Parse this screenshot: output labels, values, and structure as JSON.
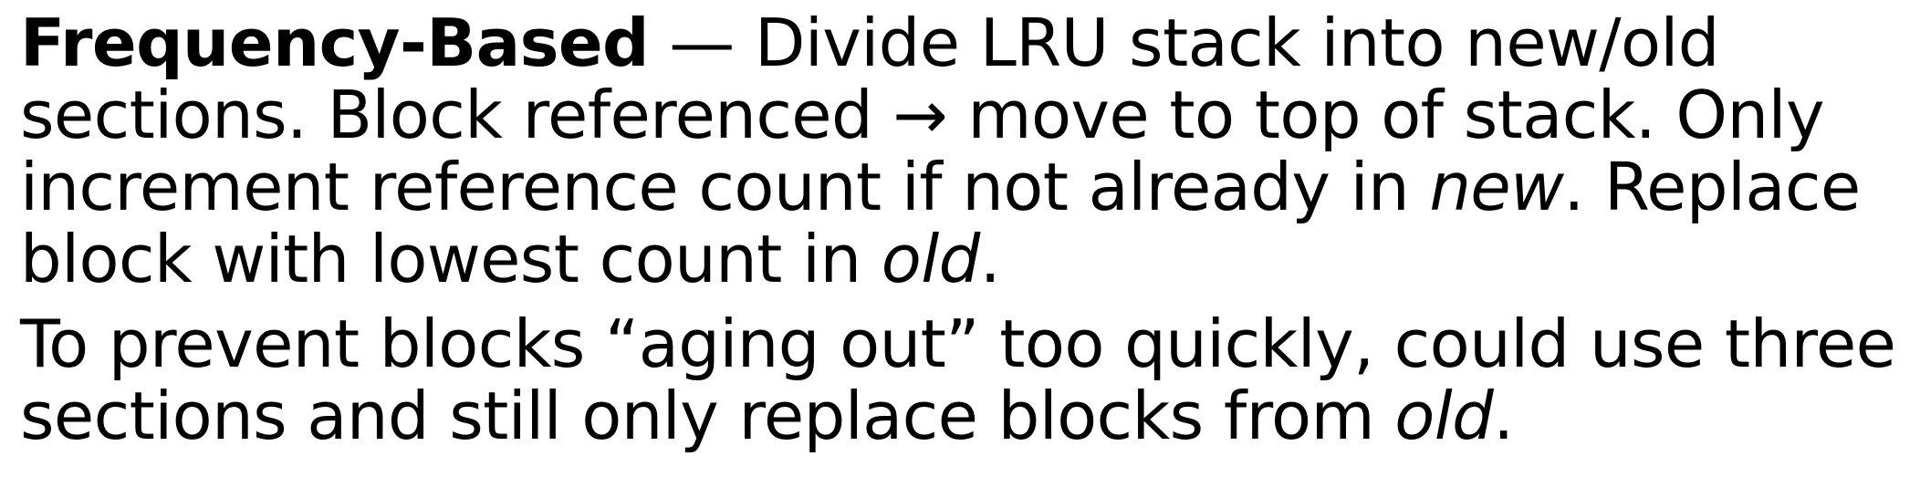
{
  "paragraphs": [
    {
      "term": "Frequency-Based",
      "segments": [
        " — Divide LRU stack into new/old sections. Block referenced → move to top of stack. Only increment reference count if not already in ",
        "new",
        ". Replace block with lowest count in ",
        "old",
        "."
      ]
    },
    {
      "segments": [
        "To prevent blocks “aging out” too quickly, could use three sections and still only replace blocks from ",
        "old",
        "."
      ]
    }
  ]
}
